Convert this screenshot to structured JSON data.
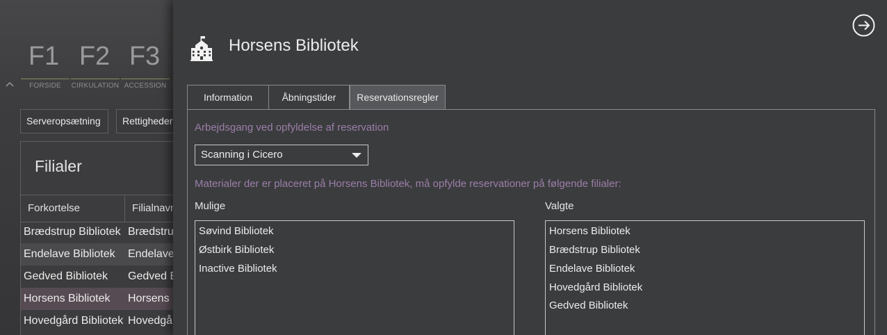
{
  "background": {
    "fkeys": [
      {
        "key": "F1",
        "label": "FORSIDE"
      },
      {
        "key": "F2",
        "label": "CIRKULATION"
      },
      {
        "key": "F3",
        "label": "ACCESSION"
      }
    ],
    "subnav": [
      "Serveropsætning",
      "Rettigheder"
    ],
    "filialer": {
      "title": "Filialer",
      "columns": [
        "Forkortelse",
        "Filialnavn"
      ],
      "rows": [
        {
          "abbr": "Brædstrup Bibliotek",
          "name": "Brædstrup"
        },
        {
          "abbr": "Endelave Bibliotek",
          "name": "Endelave"
        },
        {
          "abbr": "Gedved Bibliotek",
          "name": "Gedved B"
        },
        {
          "abbr": "Horsens Bibliotek",
          "name": "Horsens"
        },
        {
          "abbr": "Hovedgård Bibliotek",
          "name": "Hovedgård"
        }
      ]
    }
  },
  "panel": {
    "title": "Horsens Bibliotek",
    "icon": "library-building-icon",
    "close_icon": "arrow-right-circle-icon",
    "tabs": [
      {
        "label": "Information",
        "active": false
      },
      {
        "label": "Åbningstider",
        "active": false
      },
      {
        "label": "Reservationsregler",
        "active": true
      }
    ],
    "workflow_label": "Arbejdsgang ved opfyldelse af reservation",
    "workflow_value": "Scanning i Cicero",
    "materials_text": "Materialer der er placeret på Horsens Bibliotek, må opfylde reservationer på følgende filialer:",
    "possible": {
      "label": "Mulige",
      "items": [
        "Søvind Bibliotek",
        "Østbirk Bibliotek",
        "Inactive Bibliotek"
      ]
    },
    "selected": {
      "label": "Valgte",
      "items": [
        "Horsens Bibliotek",
        "Brædstrup Bibliotek",
        "Endelave Bibliotek",
        "Hovedgård Bibliotek",
        "Gedved Bibliotek"
      ]
    }
  },
  "colors": {
    "accent_purple": "#9b7fa8",
    "active_tab": "#57585b",
    "selected_row": "#574b53"
  }
}
